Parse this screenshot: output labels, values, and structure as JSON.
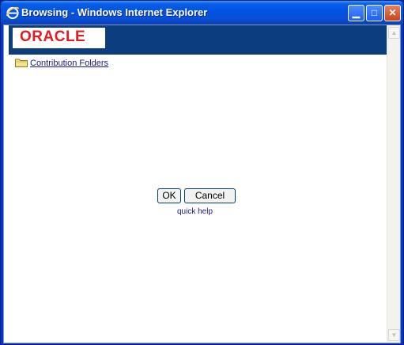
{
  "window": {
    "title": "Browsing - Windows Internet Explorer",
    "minimize_glyph": "▁",
    "maximize_glyph": "□",
    "close_glyph": "✕"
  },
  "banner": {
    "logo_text": "ORACLE"
  },
  "tree": {
    "root_label": "Contribution Folders"
  },
  "dialog": {
    "ok_label": "OK",
    "cancel_label": "Cancel",
    "help_label": "quick help"
  },
  "scrollbar": {
    "up_glyph": "▲",
    "down_glyph": "▼"
  },
  "colors": {
    "banner": "#0c3e7f",
    "logo_red": "#e31b23",
    "link": "#1a1a8c"
  },
  "icons": {
    "app": "internet-explorer-icon",
    "folder": "folder-icon"
  }
}
